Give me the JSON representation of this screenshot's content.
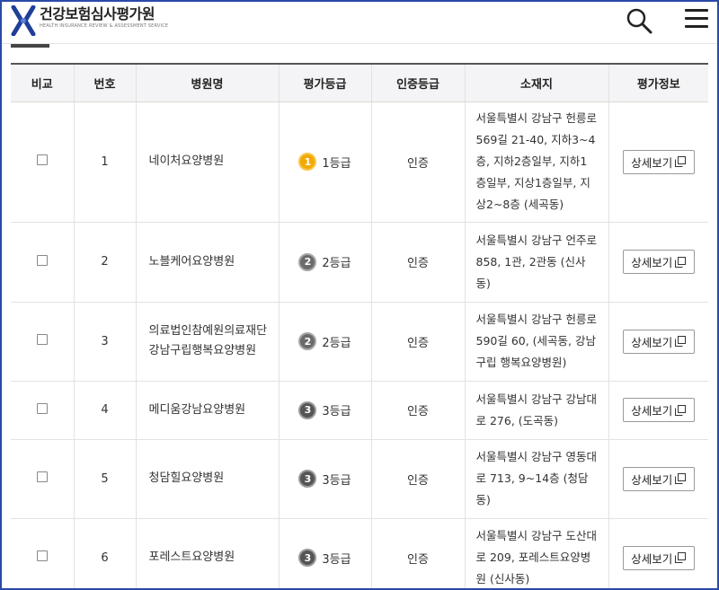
{
  "header": {
    "title": "건강보험심사평가원",
    "subtitle": "HEALTH INSURANCE REVIEW & ASSESSMENT SERVICE",
    "search_icon": "search-icon",
    "menu_icon": "hamburger-menu-icon"
  },
  "table": {
    "columns": [
      "비교",
      "번호",
      "병원명",
      "평가등급",
      "인증등급",
      "소재지",
      "평가정보"
    ],
    "rows": [
      {
        "number": "1",
        "name": "네이처요양병원",
        "grade_badge": "1",
        "grade": "1등급",
        "cert": "인증",
        "address": "서울특별시 강남구 헌릉로569길 21-40, 지하3~4층, 지하2층일부, 지하1층일부, 지상1층일부, 지상2~8층 (세곡동)",
        "detail": "상세보기"
      },
      {
        "number": "2",
        "name": "노블케어요양병원",
        "grade_badge": "2",
        "grade": "2등급",
        "cert": "인증",
        "address": "서울특별시 강남구 언주로 858, 1관, 2관동 (신사동)",
        "detail": "상세보기"
      },
      {
        "number": "3",
        "name": "의료법인참예원의료재단 강남구립행복요양병원",
        "grade_badge": "2",
        "grade": "2등급",
        "cert": "인증",
        "address": "서울특별시 강남구 헌릉로590길 60, (세곡동, 강남구립 행복요양병원)",
        "detail": "상세보기"
      },
      {
        "number": "4",
        "name": "메디움강남요양병원",
        "grade_badge": "3",
        "grade": "3등급",
        "cert": "인증",
        "address": "서울특별시 강남구 강남대로 276, (도곡동)",
        "detail": "상세보기"
      },
      {
        "number": "5",
        "name": "청담힐요양병원",
        "grade_badge": "3",
        "grade": "3등급",
        "cert": "인증",
        "address": "서울특별시 강남구 영동대로 713, 9~14층 (청담동)",
        "detail": "상세보기"
      },
      {
        "number": "6",
        "name": "포레스트요양병원",
        "grade_badge": "3",
        "grade": "3등급",
        "cert": "인증",
        "address": "서울특별시 강남구 도산대로 209, 포레스트요양병원 (신사동)",
        "detail": "상세보기"
      }
    ]
  },
  "colors": {
    "frame_border": "#2b4aa8",
    "grade1": "#f2a900",
    "grade_other": "#6b6b6b"
  }
}
